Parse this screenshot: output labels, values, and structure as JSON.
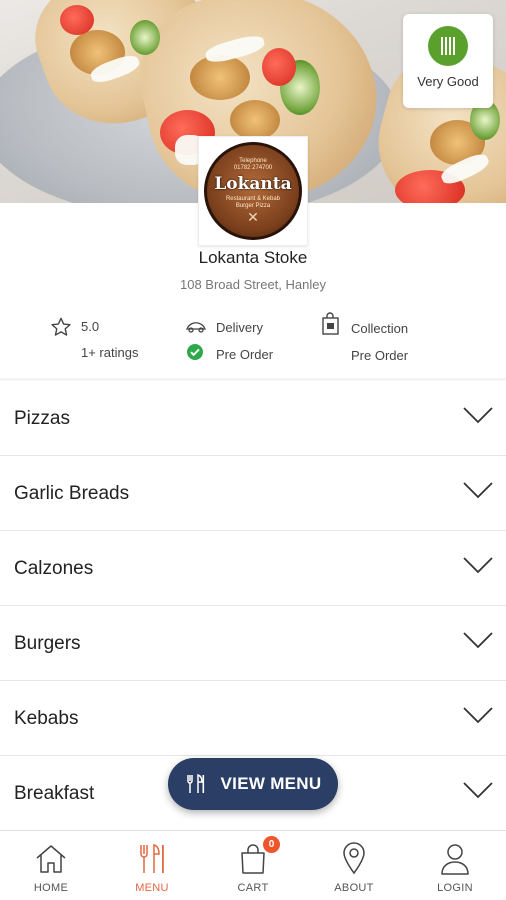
{
  "hero": {
    "rating_badge": {
      "label": "Very Good",
      "icon": "fork-knife-icon",
      "color": "#5aa02c"
    },
    "logo": {
      "brand": "Lokanta",
      "top_text": "Telephone\n01782 274700",
      "bottom_text": "Restaurant & Kebab\nBurger Pizza"
    }
  },
  "restaurant": {
    "name": "Lokanta Stoke",
    "address": "108 Broad Street, Hanley"
  },
  "info": {
    "rating_value": "5.0",
    "ratings_count": "1+ ratings",
    "delivery_label": "Delivery",
    "delivery_preorder": "Pre Order",
    "collection_label": "Collection",
    "collection_preorder": "Pre Order"
  },
  "categories": [
    {
      "label": "Pizzas"
    },
    {
      "label": "Garlic Breads"
    },
    {
      "label": "Calzones"
    },
    {
      "label": "Burgers"
    },
    {
      "label": "Kebabs"
    },
    {
      "label": "Breakfast"
    }
  ],
  "view_menu_button": {
    "label": "VIEW MENU",
    "color": "#2b3e66"
  },
  "tabbar": {
    "items": [
      {
        "label": "HOME",
        "icon": "home-icon"
      },
      {
        "label": "MENU",
        "icon": "menu-icon",
        "active": true
      },
      {
        "label": "CART",
        "icon": "cart-icon",
        "badge": "0"
      },
      {
        "label": "ABOUT",
        "icon": "location-icon"
      },
      {
        "label": "LOGIN",
        "icon": "user-icon"
      }
    ],
    "active_color": "#e3673f"
  }
}
